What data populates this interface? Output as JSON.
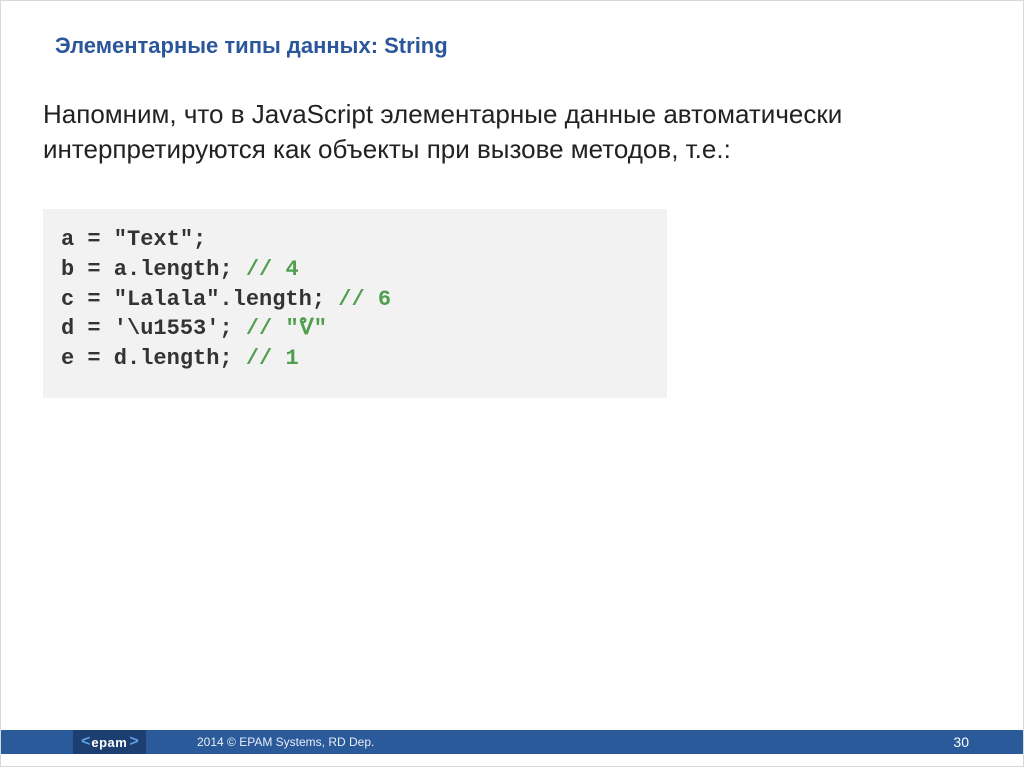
{
  "title": "Элементарные типы данных: String",
  "body_text": "Напомним, что в JavaScript элементарные данные автоматически интерпретируются как объекты при вызове методов, т.е.:",
  "code": {
    "l1a": "a = \"Text\";",
    "l2a": "b = a.length; ",
    "l2c": "// 4",
    "l3a": "c = \"Lalala\".length; ",
    "l3c": "// 6",
    "l4a": "d = '\\u1553'; ",
    "l4c": "// \"ᕓ\"",
    "l5a": "e = d.length; ",
    "l5c": "// 1"
  },
  "footer": {
    "logo_left": "<",
    "logo_text": "epam",
    "logo_right": ">",
    "copyright": "2014 © EPAM Systems, RD Dep.",
    "page": "30"
  }
}
